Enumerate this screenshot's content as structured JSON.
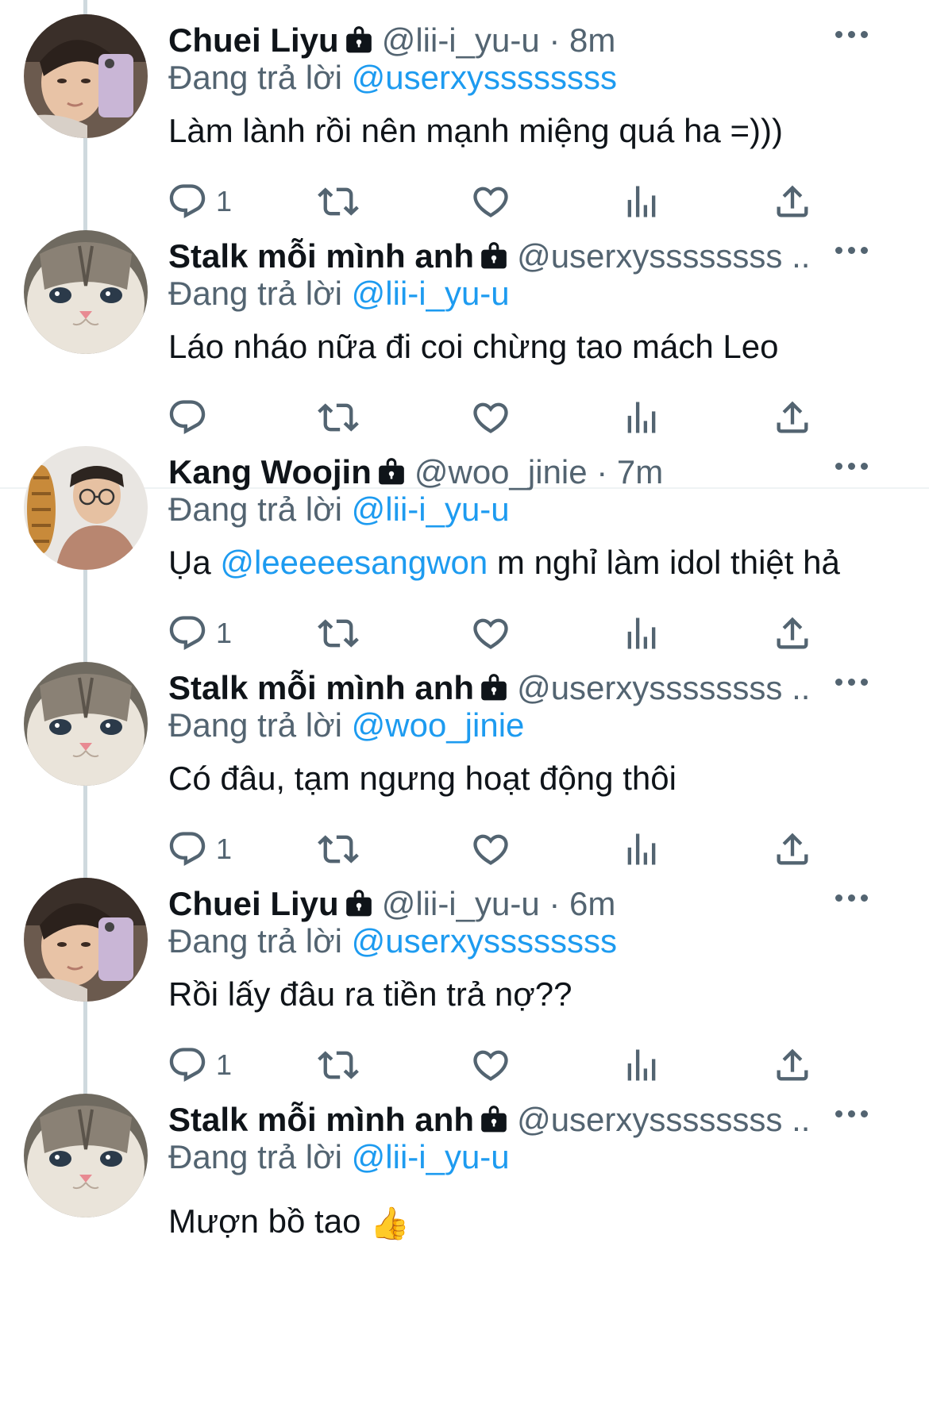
{
  "replying_prefix": "Đang trả lời",
  "tweets": [
    {
      "name": "Chuei Liyu",
      "meta": "@lii-i_yu-u · 8m",
      "reply_to": "@userxyssssssss",
      "text": "Làm lành rồi nên mạnh miệng quá ha =)))",
      "reply_count": "1",
      "avatar": "person-selfie-avatar"
    },
    {
      "name": "Stalk mỗi mình anh",
      "meta": "@userxyssssssss ...",
      "reply_to": "@lii-i_yu-u",
      "text": "Láo nháo nữa đi coi chừng tao mách Leo",
      "reply_count": "",
      "avatar": "cat-avatar"
    },
    {
      "name": "Kang Woojin",
      "meta": "@woo_jinie · 7m",
      "reply_to": "@lii-i_yu-u",
      "text_before": "Ụa ",
      "text_mention": "@leeeeesangwon",
      "text_after": " m nghỉ làm idol thiệt hả",
      "reply_count": "1",
      "avatar": "glasses-person-avatar"
    },
    {
      "name": "Stalk mỗi mình anh",
      "meta": "@userxyssssssss ...",
      "reply_to": "@woo_jinie",
      "text": "Có đâu, tạm ngưng hoạt động thôi",
      "reply_count": "1",
      "avatar": "cat-avatar"
    },
    {
      "name": "Chuei Liyu",
      "meta": "@lii-i_yu-u · 6m",
      "reply_to": "@userxyssssssss",
      "text": "Rồi lấy đâu ra tiền trả nợ??",
      "reply_count": "1",
      "avatar": "person-selfie-avatar"
    },
    {
      "name": "Stalk mỗi mình anh",
      "meta": "@userxyssssssss ...",
      "reply_to": "@lii-i_yu-u",
      "text": "Mượn bồ tao",
      "emoji": "👍",
      "avatar": "cat-avatar"
    }
  ],
  "colors": {
    "link": "#1d9bf0",
    "secondary": "#536471",
    "thread": "#cfd9de"
  }
}
